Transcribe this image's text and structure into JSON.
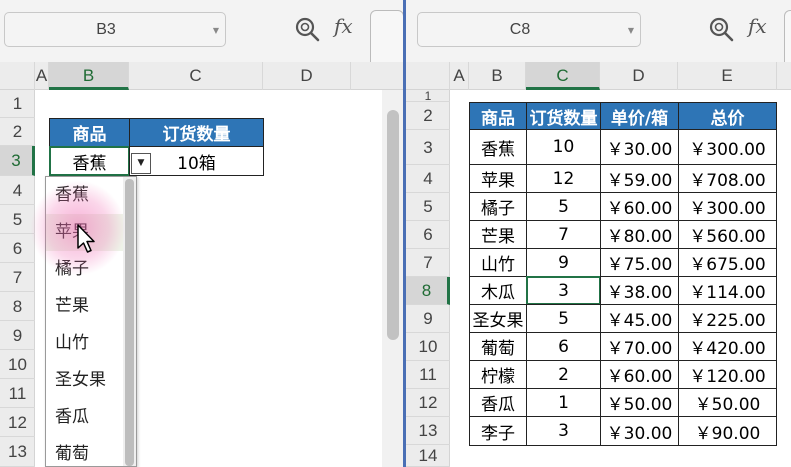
{
  "left": {
    "name_box": "B3",
    "fx_label": "fx",
    "columns": [
      "A",
      "B",
      "C",
      "D"
    ],
    "rows": [
      "1",
      "2",
      "3",
      "4",
      "5",
      "6",
      "7",
      "8",
      "9",
      "10",
      "11",
      "12",
      "13"
    ],
    "header": {
      "product": "商品",
      "quantity": "订货数量"
    },
    "row3": {
      "product": "香蕉",
      "quantity": "10箱"
    },
    "dropdown_options": [
      "香蕉",
      "苹果",
      "橘子",
      "芒果",
      "山竹",
      "圣女果",
      "香瓜",
      "葡萄"
    ],
    "hover_option_index": 1
  },
  "right": {
    "name_box": "C8",
    "fx_label": "fx",
    "columns": [
      "A",
      "B",
      "C",
      "D",
      "E"
    ],
    "rows": [
      "1",
      "2",
      "3",
      "4",
      "5",
      "6",
      "7",
      "8",
      "9",
      "10",
      "11",
      "12",
      "13",
      "14"
    ],
    "headers": [
      "商品",
      "订货数量",
      "单价/箱",
      "总价"
    ],
    "table": [
      [
        "香蕉",
        "10",
        "￥30.00",
        "￥300.00"
      ],
      [
        "苹果",
        "12",
        "￥59.00",
        "￥708.00"
      ],
      [
        "橘子",
        "5",
        "￥60.00",
        "￥300.00"
      ],
      [
        "芒果",
        "7",
        "￥80.00",
        "￥560.00"
      ],
      [
        "山竹",
        "9",
        "￥75.00",
        "￥675.00"
      ],
      [
        "木瓜",
        "3",
        "￥38.00",
        "￥114.00"
      ],
      [
        "圣女果",
        "5",
        "￥45.00",
        "￥225.00"
      ],
      [
        "葡萄",
        "6",
        "￥70.00",
        "￥420.00"
      ],
      [
        "柠檬",
        "2",
        "￥60.00",
        "￥120.00"
      ],
      [
        "香瓜",
        "1",
        "￥50.00",
        "￥50.00"
      ],
      [
        "李子",
        "3",
        "￥30.00",
        "￥90.00"
      ]
    ]
  },
  "colors": {
    "header_fill": "#2e75b6",
    "selection_green": "#217346",
    "split_bar": "#4a6fb5"
  },
  "icons": {
    "zoom": "zoom-magnifier-icon",
    "function": "fx-icon",
    "dropdown": "dropdown-arrow-icon",
    "cursor": "mouse-pointer-icon"
  }
}
